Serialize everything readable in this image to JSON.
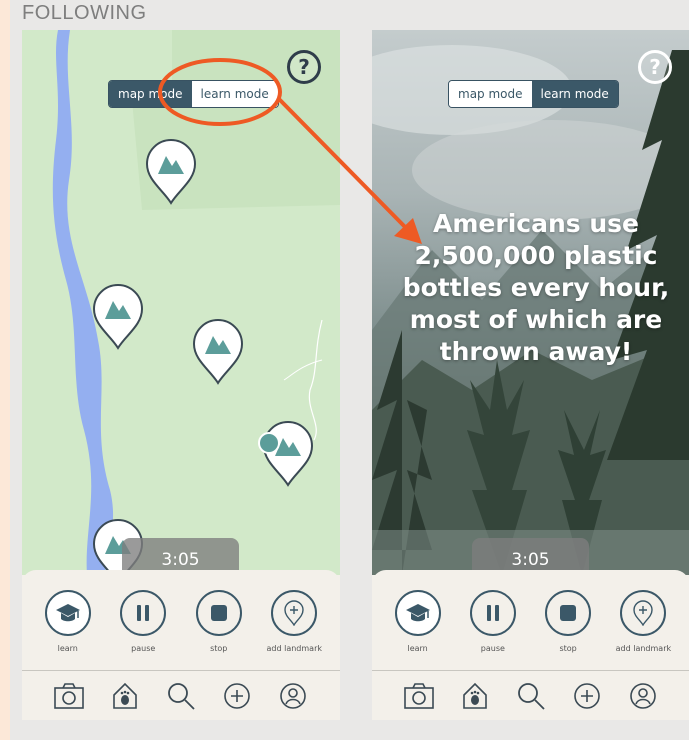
{
  "heading": "FOLLOWING",
  "help_symbol": "?",
  "mode_toggle": {
    "map_label": "map mode",
    "learn_label": "learn mode"
  },
  "left_screen": {
    "active_mode": "map mode",
    "timer": "3:05"
  },
  "right_screen": {
    "active_mode": "learn mode",
    "timer": "3:05",
    "fact": "Americans use 2,500,000 plastic bottles every hour, most of which are thrown away!"
  },
  "actions": {
    "learn": "learn",
    "pause": "pause",
    "stop": "stop",
    "add_landmark": "add landmark"
  },
  "nav_icons": [
    "camera-icon",
    "footprint-home-icon",
    "search-icon",
    "add-icon",
    "profile-icon"
  ],
  "colors": {
    "primary": "#3b5868",
    "marker": "#5c9d9a",
    "water": "#94aff0",
    "land": "#d2e9c9",
    "annotation": "#ee5a24",
    "background": "#fce8d8"
  }
}
